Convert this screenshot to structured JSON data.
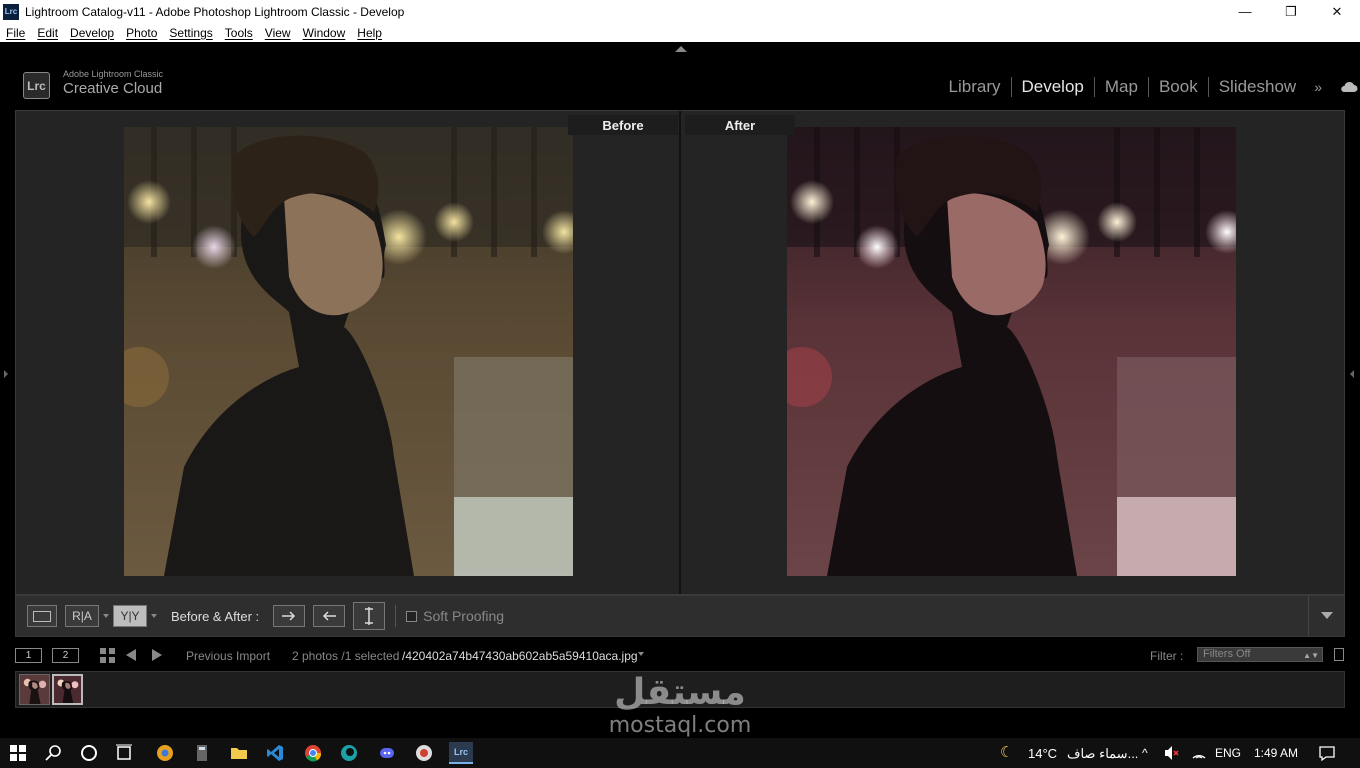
{
  "titlebar": {
    "icon_label": "Lrc",
    "title": "Lightroom Catalog-v11 - Adobe Photoshop Lightroom Classic - Develop",
    "minimize": "—",
    "restore": "❐",
    "close": "✕"
  },
  "menu": [
    "File",
    "Edit",
    "Develop",
    "Photo",
    "Settings",
    "Tools",
    "View",
    "Window",
    "Help"
  ],
  "header": {
    "badge": "Lrc",
    "brand_small": "Adobe Lightroom Classic",
    "brand_big": "Creative Cloud",
    "modules": [
      "Library",
      "Develop",
      "Map",
      "Book",
      "Slideshow"
    ],
    "active_module": "Develop",
    "more": "»"
  },
  "view": {
    "before_label": "Before",
    "after_label": "After"
  },
  "toolbar": {
    "ra_label": "R|A",
    "yy_label": "Y|Y",
    "before_after_label": "Before & After :",
    "soft_proofing_label": "Soft Proofing",
    "soft_proofing_checked": false
  },
  "filmstrip_bar": {
    "monitor1": "1",
    "monitor2": "2",
    "source": "Previous Import",
    "count": "2 photos /1 selected",
    "filename": "/420402a74b47430ab602ab5a59410aca.jpg",
    "filter_label": "Filter :",
    "filter_value": "Filters Off"
  },
  "watermark": {
    "arabic": "مستقل",
    "latin": "mostaql.com"
  },
  "taskbar": {
    "weather_temp": "14°C",
    "weather_text": "سماء صاف...",
    "lang": "ENG",
    "time": "1:49 AM",
    "pinned": [
      "start-icon",
      "search-icon",
      "cortana-icon",
      "task-view-icon",
      "chrome-canary-icon",
      "calculator-icon",
      "file-explorer-icon",
      "vscode-icon",
      "chrome-icon",
      "edge-icon",
      "discord-icon",
      "obs-icon",
      "lightroom-icon"
    ]
  },
  "colors": {
    "accent_active": "#e6e6e6",
    "panel_bg": "#242424",
    "toolbar_bg": "#2e2e2e"
  }
}
